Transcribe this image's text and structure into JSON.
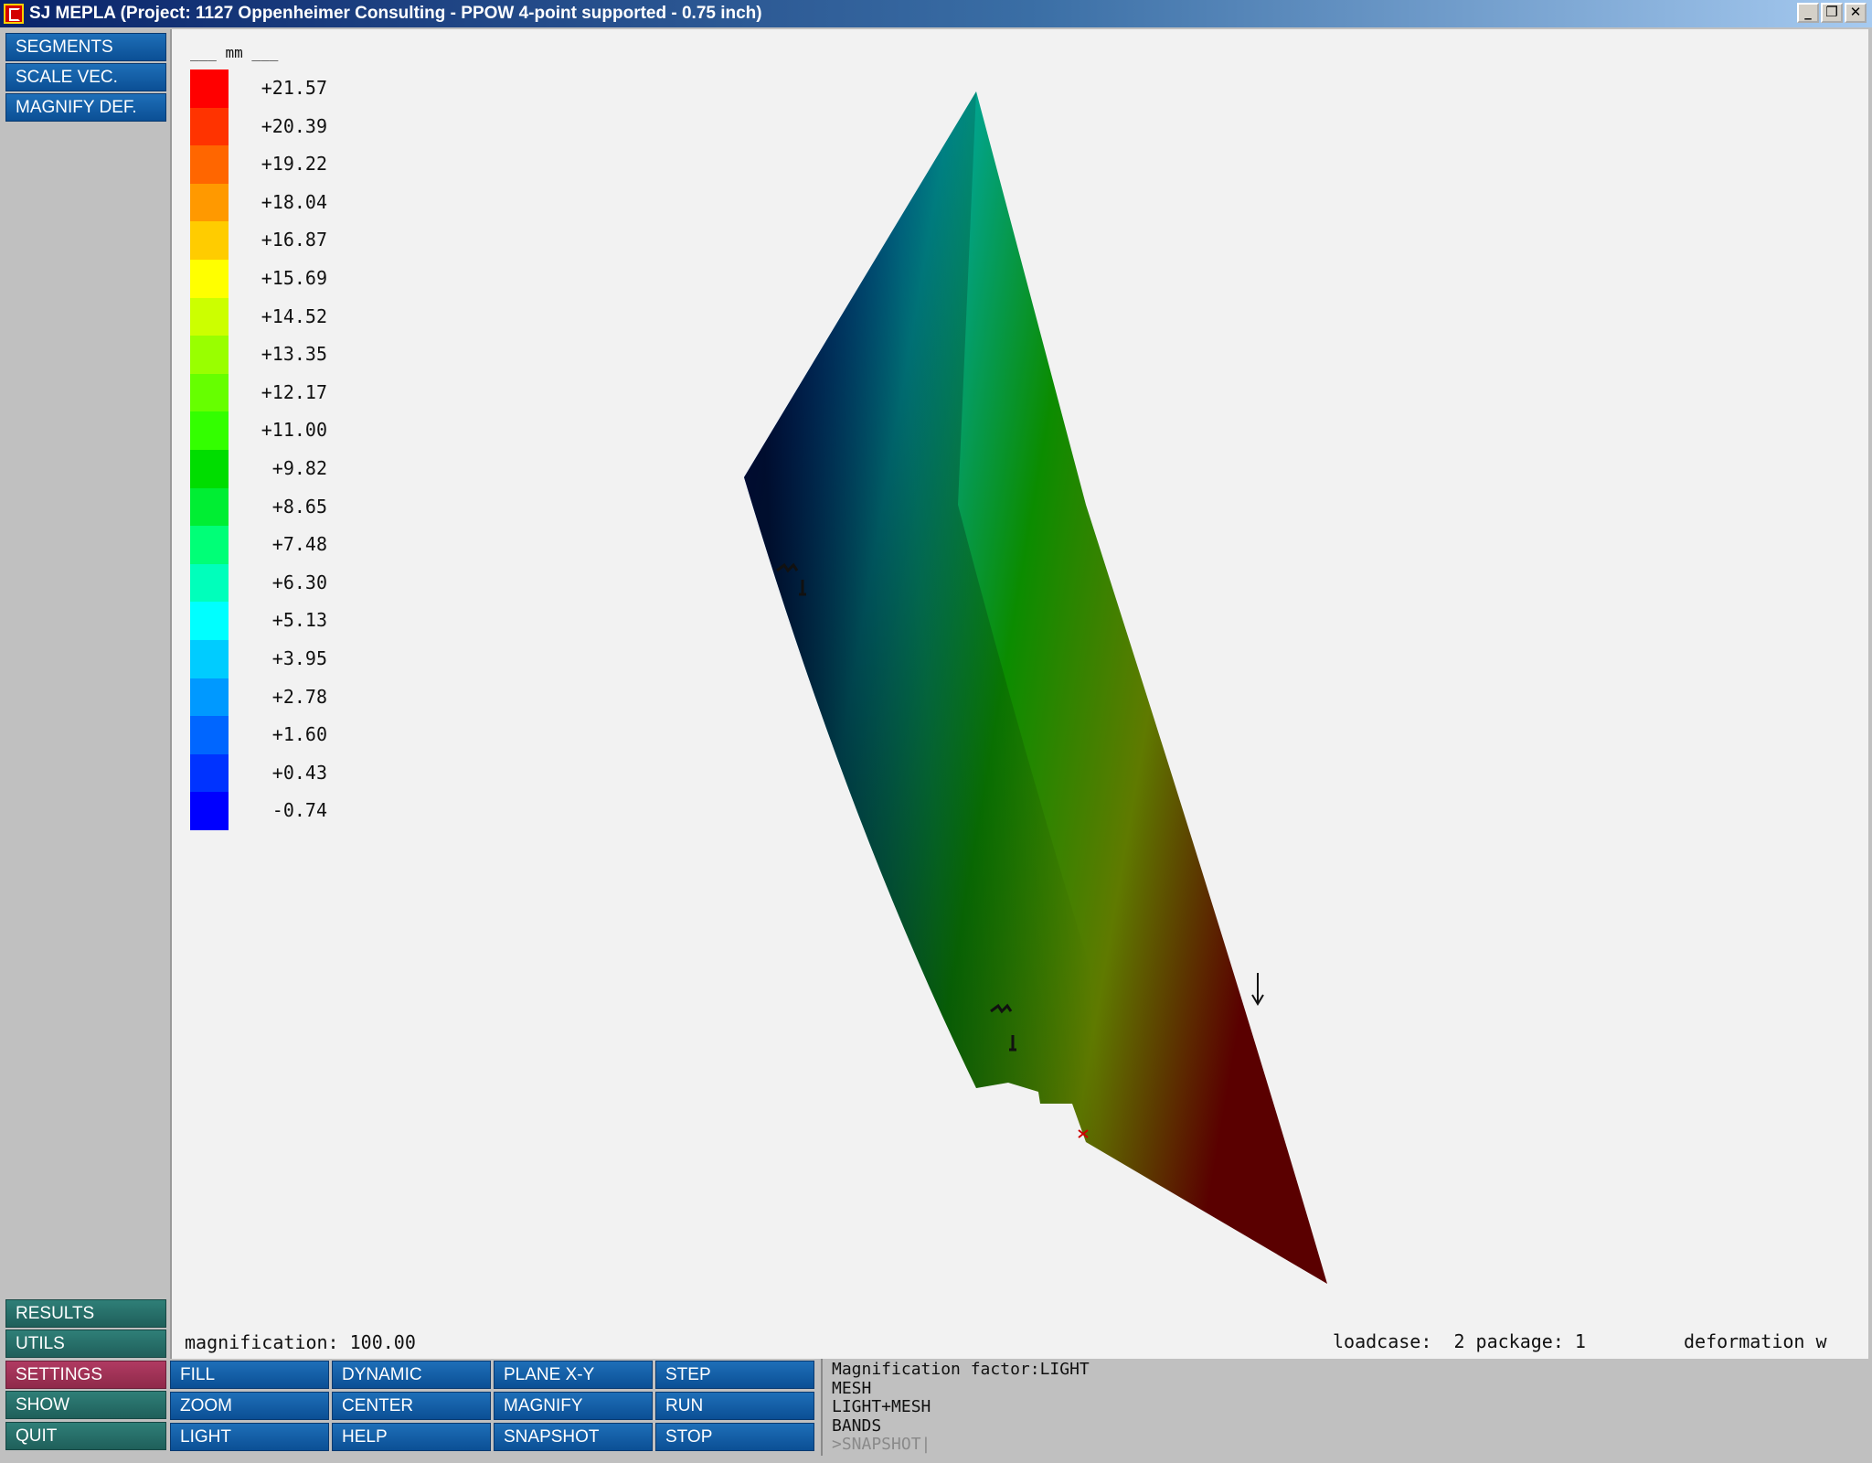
{
  "window": {
    "title": "SJ MEPLA (Project: 1127 Oppenheimer Consulting - PPOW 4-point supported - 0.75 inch)",
    "minimize_glyph": "_",
    "restore_glyph": "❐",
    "close_glyph": "✕"
  },
  "side_top": [
    "SEGMENTS",
    "SCALE VEC.",
    "MAGNIFY DEF."
  ],
  "side_bottom": [
    "RESULTS",
    "UTILS",
    "SETTINGS",
    "SHOW",
    "QUIT"
  ],
  "legend": {
    "unit": "___ mm ___",
    "values": [
      "+21.57",
      "+20.39",
      "+19.22",
      "+18.04",
      "+16.87",
      "+15.69",
      "+14.52",
      "+13.35",
      "+12.17",
      "+11.00",
      "+9.82",
      "+8.65",
      "+7.48",
      "+6.30",
      "+5.13",
      "+3.95",
      "+2.78",
      "+1.60",
      "+0.43",
      "-0.74"
    ],
    "colors": [
      "#ff0000",
      "#ff3300",
      "#ff6600",
      "#ff9900",
      "#ffcc00",
      "#ffff00",
      "#ccff00",
      "#99ff00",
      "#66ff00",
      "#33ff00",
      "#00dd00",
      "#00ee33",
      "#00ff77",
      "#00ffbb",
      "#00ffff",
      "#00ccff",
      "#0099ff",
      "#0066ff",
      "#0033ff",
      "#0000ff"
    ]
  },
  "status": {
    "magnification": "magnification: 100.00",
    "loadcase": "loadcase:  2 package: 1",
    "deformation": "deformation w"
  },
  "toolbar": {
    "col1": [
      "FILL",
      "ZOOM",
      "LIGHT"
    ],
    "col2": [
      "DYNAMIC",
      "CENTER",
      "HELP"
    ],
    "col3": [
      "PLANE X-Y",
      "MAGNIFY",
      "SNAPSHOT"
    ],
    "col4": [
      "STEP",
      "RUN",
      "STOP"
    ]
  },
  "console": {
    "lines": [
      "Magnification factor:LIGHT",
      "MESH",
      "LIGHT+MESH",
      "BANDS"
    ],
    "prompt": ">SNAPSHOT|"
  },
  "plate_colors": {
    "blue": "#0018ff",
    "teal": "#00a5a0",
    "green": "#0a8a00",
    "olive": "#6a7a00",
    "dark_red": "#5a0000"
  }
}
